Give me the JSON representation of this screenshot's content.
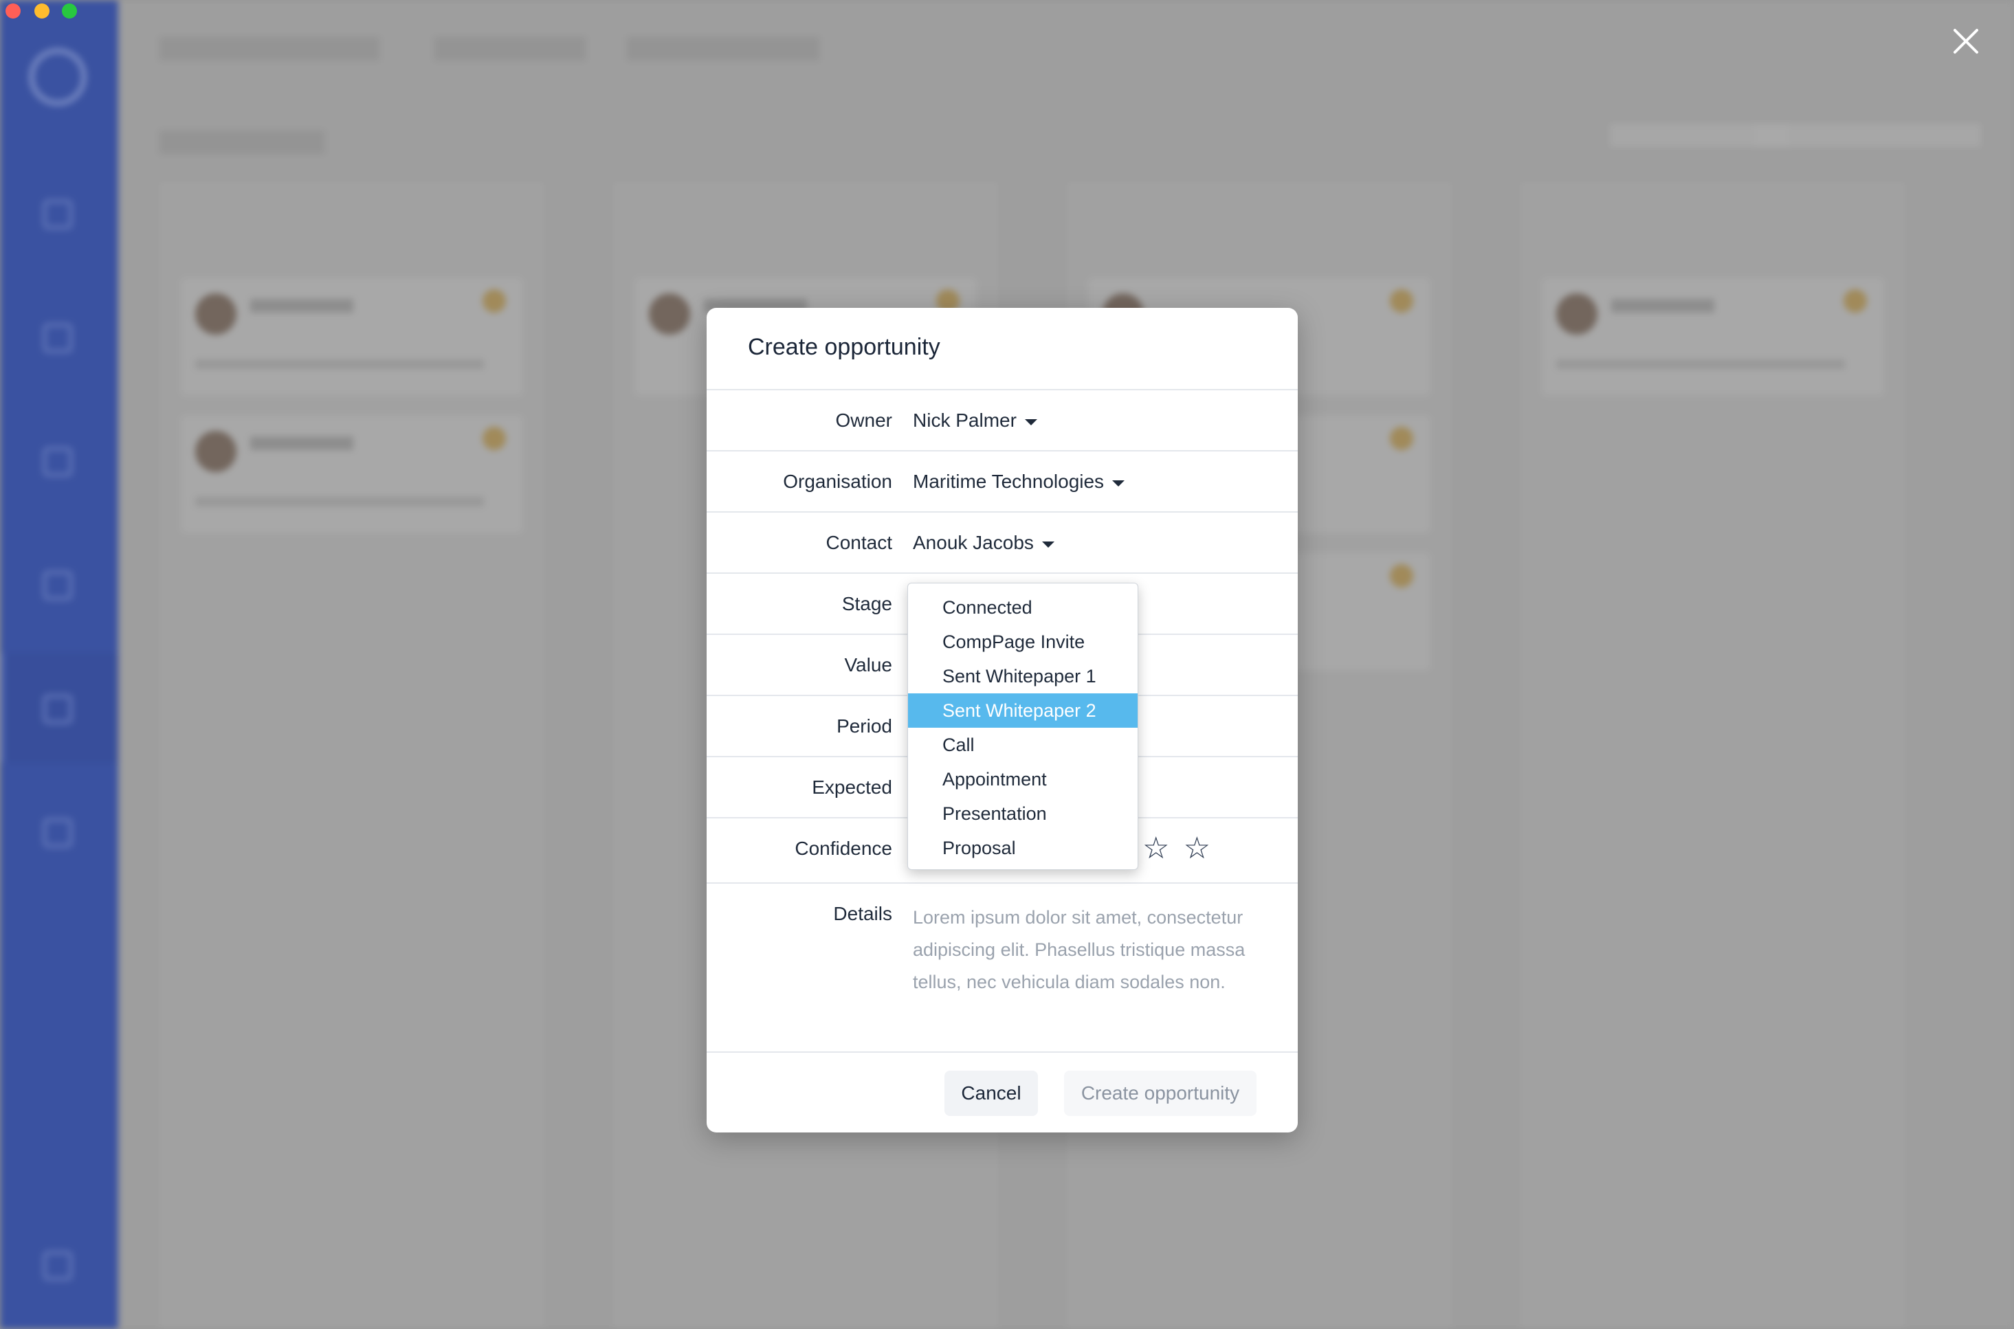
{
  "window": {
    "traffic_lights": [
      "#ff5f57",
      "#febc2e",
      "#28c840"
    ]
  },
  "modal": {
    "title": "Create opportunity",
    "fields": {
      "owner": {
        "label": "Owner",
        "value": "Nick Palmer"
      },
      "organisation": {
        "label": "Organisation",
        "value": "Maritime Technologies"
      },
      "contact": {
        "label": "Contact",
        "value": "Anouk Jacobs"
      },
      "stage": {
        "label": "Stage"
      },
      "value": {
        "label": "Value"
      },
      "period": {
        "label": "Period"
      },
      "expected": {
        "label": "Expected"
      },
      "confidence": {
        "label": "Confidence",
        "stars_visible": "☆ ☆"
      },
      "details": {
        "label": "Details",
        "placeholder": "Lorem ipsum dolor sit amet, consectetur adipiscing elit. Phasellus tristique massa tellus, nec vehicula diam sodales non."
      }
    },
    "buttons": {
      "cancel": "Cancel",
      "create": "Create opportunity"
    }
  },
  "stage_dropdown": {
    "options": [
      "Connected",
      "CompPage Invite",
      "Sent Whitepaper 1",
      "Sent Whitepaper 2",
      "Call",
      "Appointment",
      "Presentation",
      "Proposal"
    ],
    "selected": "Sent Whitepaper 2",
    "highlight_color": "#57b9ed"
  },
  "icons": {
    "close": "close-icon",
    "caret": "caret-down-icon",
    "star": "star-outline-icon"
  }
}
